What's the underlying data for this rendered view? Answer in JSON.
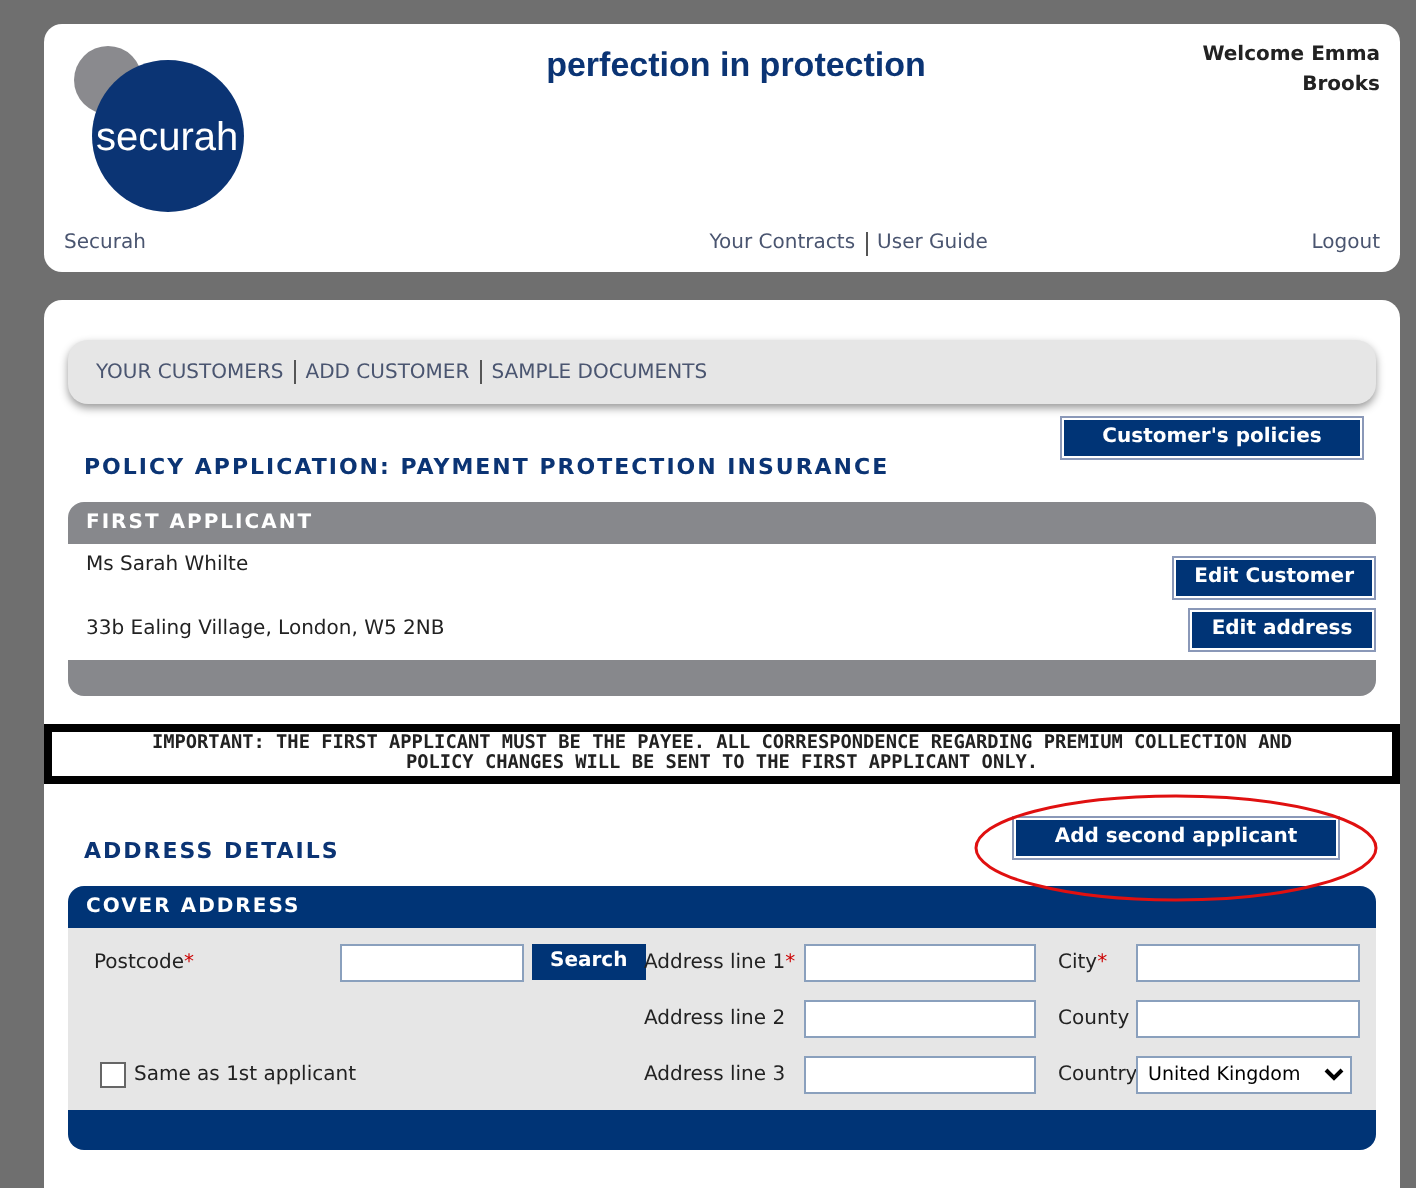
{
  "header": {
    "logo_text": "securah",
    "tagline": "perfection in protection",
    "welcome": "Welcome Emma Brooks",
    "links_left": "Securah",
    "links_center": [
      "Your Contracts",
      "User Guide"
    ],
    "logout": "Logout"
  },
  "menu": [
    "YOUR CUSTOMERS",
    "ADD CUSTOMER",
    "SAMPLE DOCUMENTS"
  ],
  "policy_title": "POLICY APPLICATION: PAYMENT PROTECTION INSURANCE",
  "policies_button": "Customer's policies",
  "first_applicant": {
    "title": "FIRST APPLICANT",
    "name": "Ms Sarah Whilte",
    "address": "33b Ealing Village, London, W5 2NB",
    "buttons": [
      "Edit Customer",
      "Edit address"
    ]
  },
  "notice": "IMPORTANT: THE FIRST APPLICANT MUST BE THE PAYEE. ALL CORRESPONDENCE REGARDING PREMIUM COLLECTION AND POLICY CHANGES WILL BE SENT TO THE FIRST APPLICANT ONLY.",
  "address_title": "ADDRESS DETAILS",
  "second_button": "Add second applicant",
  "highlighted": true,
  "cover_address": {
    "title": "COVER ADDRESS",
    "postcode": {
      "label": "Postcode",
      "marker": "*",
      "button": "Search"
    },
    "same_as_first": {
      "label": "Same as 1st applicant",
      "checked": false
    },
    "middle": [
      {
        "label": "Address line 1",
        "marker": "*"
      },
      {
        "label": "Address line 2"
      },
      {
        "label": "Address line 3"
      }
    ],
    "right": [
      {
        "label": "City",
        "marker": "*",
        "kind": "text"
      },
      {
        "label": "County",
        "kind": "text"
      },
      {
        "label": "Country",
        "kind": "select",
        "value": "United Kingdom"
      }
    ]
  }
}
